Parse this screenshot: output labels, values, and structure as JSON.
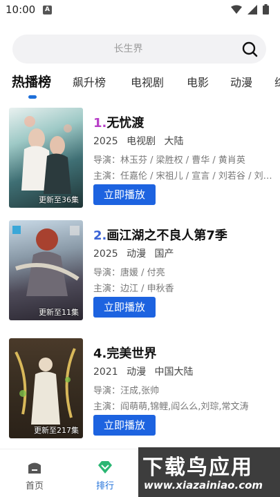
{
  "status": {
    "time": "10:00",
    "notif_letter": "A"
  },
  "search": {
    "placeholder": "长生界"
  },
  "tabs": [
    "热播榜",
    "飙升榜",
    "电视剧",
    "电影",
    "动漫",
    "综"
  ],
  "items": [
    {
      "rank": "1.",
      "rank_color": "#b73ec7",
      "title": "无忧渡",
      "year": "2025",
      "genre": "电视剧",
      "region": "大陆",
      "director": "导演：林玉芬 / 梁胜权 / 曹华 / 黄肖英",
      "cast": "主演：任嘉伦 / 宋祖儿 / 宣言 / 刘若谷 / 刘…",
      "badge": "更新至36集",
      "play_label": "立即播放"
    },
    {
      "rank": "2.",
      "rank_color": "#3a63d6",
      "title": "画江湖之不良人第7季",
      "year": "2025",
      "genre": "动漫",
      "region": "国产",
      "director": "导演：唐媛 / 付亮",
      "cast": "主演：边江 / 申秋香",
      "badge": "更新至11集",
      "play_label": "立即播放"
    },
    {
      "rank": "4.",
      "rank_color": "#111111",
      "title": "完美世界",
      "year": "2021",
      "genre": "动漫",
      "region": "中国大陆",
      "director": "导演：汪成,张帅",
      "cast": "主演：阎萌萌,锦鲤,阎么么,刘琮,常文涛",
      "badge": "更新至217集",
      "play_label": "立即播放"
    }
  ],
  "nav": {
    "home": "首页",
    "rank": "排行"
  },
  "watermark": {
    "title": "下载鸟应用",
    "url": "www.xiazainiao.com"
  },
  "colors": {
    "accent": "#1e6fd9",
    "button": "#1d63e0"
  }
}
